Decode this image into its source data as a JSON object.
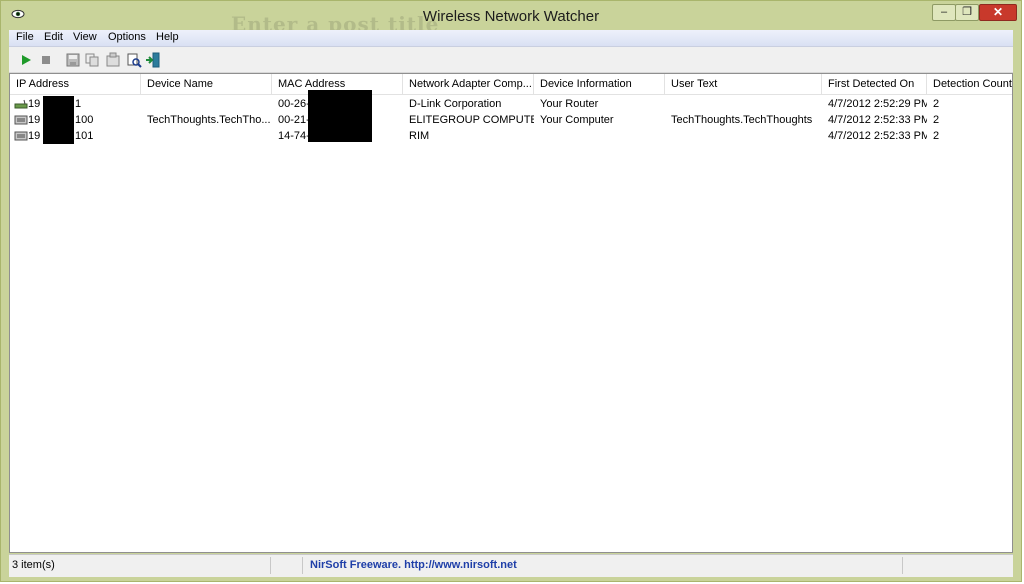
{
  "window": {
    "title": "Wireless Network Watcher",
    "background_ghost_text": "Enter a post title"
  },
  "menu": [
    "File",
    "Edit",
    "View",
    "Options",
    "Help"
  ],
  "toolbar": [
    {
      "icon": "play-icon"
    },
    {
      "icon": "stop-icon"
    },
    {
      "icon": "save-icon"
    },
    {
      "icon": "copy-icon"
    },
    {
      "icon": "properties-icon"
    },
    {
      "icon": "find-icon"
    },
    {
      "icon": "exit-icon"
    }
  ],
  "columns": [
    "IP Address",
    "Device Name",
    "MAC Address",
    "Network Adapter Comp...",
    "Device Information",
    "User Text",
    "First Detected On",
    "Detection Count"
  ],
  "rows": [
    {
      "icon": "router-icon",
      "ip_prefix": "19",
      "ip_suffix": "1",
      "device_name": "",
      "mac_prefix": "00-26-",
      "adapter_company": "D-Link Corporation",
      "device_info": "Your Router",
      "user_text": "",
      "first_detected": "4/7/2012 2:52:29 PM",
      "count": "2"
    },
    {
      "icon": "computer-icon",
      "ip_prefix": "19",
      "ip_suffix": "100",
      "device_name": "TechThoughts.TechTho...",
      "mac_prefix": "00-21-",
      "adapter_company": "ELITEGROUP COMPUTE...",
      "device_info": "Your Computer",
      "user_text": "TechThoughts.TechThoughts",
      "first_detected": "4/7/2012 2:52:33 PM",
      "count": "2"
    },
    {
      "icon": "computer-icon",
      "ip_prefix": "19",
      "ip_suffix": "101",
      "device_name": "",
      "mac_prefix": "14-74-",
      "adapter_company": "RIM",
      "device_info": "",
      "user_text": "",
      "first_detected": "4/7/2012 2:52:33 PM",
      "count": "2"
    }
  ],
  "status": {
    "items": "3 item(s)",
    "freeware": "NirSoft Freeware.  http://www.nirsoft.net"
  },
  "colors": {
    "frame": "#c9d39a",
    "close_button": "#c8392b",
    "link": "#1f3fa8"
  }
}
